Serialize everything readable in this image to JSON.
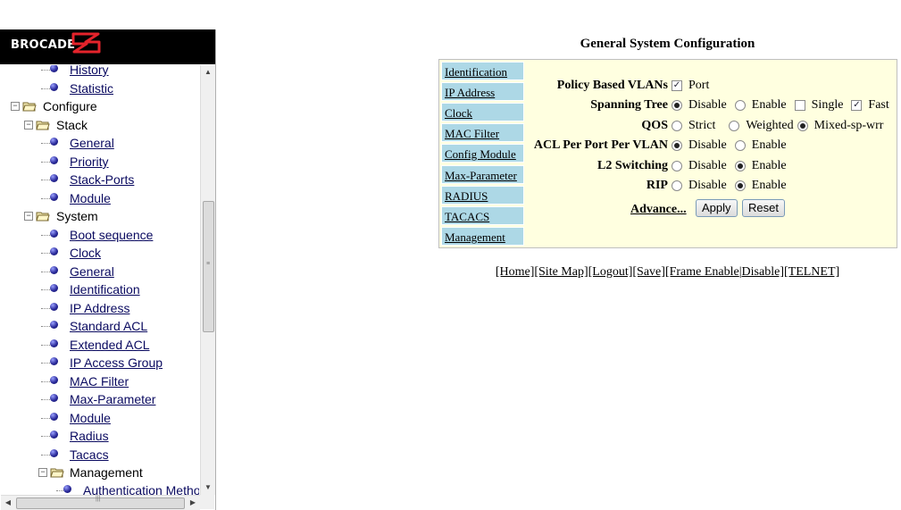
{
  "brand": {
    "logo_text": "BROCADE"
  },
  "tree": {
    "items": [
      {
        "label": "History",
        "link": true
      },
      {
        "label": "Statistic",
        "link": true
      },
      {
        "label": "Configure",
        "link": false
      },
      {
        "label": "Stack",
        "link": false
      },
      {
        "label": "General",
        "link": true
      },
      {
        "label": "Priority",
        "link": true
      },
      {
        "label": "Stack-Ports",
        "link": true
      },
      {
        "label": "Module",
        "link": true
      },
      {
        "label": "System",
        "link": false
      },
      {
        "label": "Boot sequence",
        "link": true
      },
      {
        "label": "Clock",
        "link": true
      },
      {
        "label": "General",
        "link": true
      },
      {
        "label": "Identification",
        "link": true
      },
      {
        "label": "IP Address",
        "link": true
      },
      {
        "label": "Standard ACL",
        "link": true
      },
      {
        "label": "Extended ACL",
        "link": true
      },
      {
        "label": "IP Access Group",
        "link": true
      },
      {
        "label": "MAC Filter",
        "link": true
      },
      {
        "label": "Max-Parameter",
        "link": true
      },
      {
        "label": "Module",
        "link": true
      },
      {
        "label": "Radius",
        "link": true
      },
      {
        "label": "Tacacs",
        "link": true
      },
      {
        "label": "Management",
        "link": false
      },
      {
        "label": "Authentication Metho",
        "link": true
      }
    ]
  },
  "main": {
    "title": "General System Configuration",
    "nav": [
      "Identification",
      "IP Address",
      "Clock",
      "MAC Filter",
      "Config Module",
      "Max-Parameter",
      "RADIUS",
      "TACACS",
      "Management"
    ],
    "form": {
      "policy_vlans": {
        "label": "Policy Based VLANs",
        "option": "Port",
        "checked": true
      },
      "spanning_tree": {
        "label": "Spanning Tree",
        "disable": "Disable",
        "enable": "Enable",
        "single": "Single",
        "fast": "Fast",
        "selected": "Disable",
        "single_checked": false,
        "fast_checked": true
      },
      "qos": {
        "label": "QOS",
        "strict": "Strict",
        "weighted": "Weighted",
        "mixed": "Mixed-sp-wrr",
        "selected": "Mixed-sp-wrr"
      },
      "acl_per_port": {
        "label": "ACL Per Port Per VLAN",
        "disable": "Disable",
        "enable": "Enable",
        "selected": "Disable"
      },
      "l2_switching": {
        "label": "L2 Switching",
        "disable": "Disable",
        "enable": "Enable",
        "selected": "Enable"
      },
      "rip": {
        "label": "RIP",
        "disable": "Disable",
        "enable": "Enable",
        "selected": "Enable"
      },
      "advance_label": "Advance...",
      "apply_label": "Apply",
      "reset_label": "Reset"
    },
    "footer": {
      "home": "[Home]",
      "site_map": "[Site Map]",
      "logout": "[Logout]",
      "save": "[Save]",
      "frame_enable": "[Frame Enable",
      "sep": "|",
      "disable": "Disable]",
      "telnet": "[TELNET]"
    }
  }
}
